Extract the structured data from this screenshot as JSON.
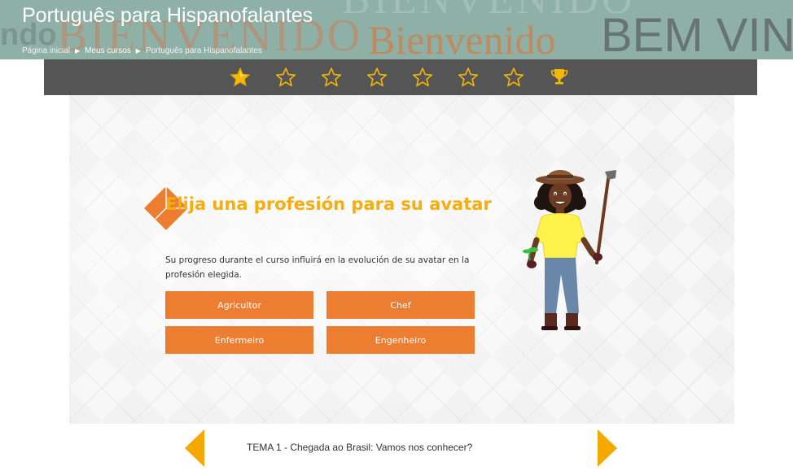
{
  "header": {
    "title": "Português para Hispanofalantes",
    "banner_words": [
      "BIENVENIDO",
      "BIENVENIDO",
      "ndo",
      "Bienvenido",
      "BEM VIND"
    ],
    "breadcrumb": [
      {
        "label": "Página inicial"
      },
      {
        "label": "Meus cursos"
      },
      {
        "label": "Português para Hispanofalantes"
      }
    ]
  },
  "progress": {
    "stars_total": 7,
    "stars_filled": 1,
    "star_filled_icon": "star-filled-icon",
    "star_empty_icon": "star-outline-icon",
    "final_icon": "trophy-icon",
    "accent_color": "#f5b800"
  },
  "main": {
    "heading": "Elija una profesión para su avatar",
    "description": "Su progreso durante el curso influirá en la evolución de su avatar en la profesión elegida.",
    "professions": [
      {
        "label": "Agricultor"
      },
      {
        "label": "Chef"
      },
      {
        "label": "Enfermeiro"
      },
      {
        "label": "Engenheiro"
      }
    ],
    "button_color": "#ed7d31",
    "heading_color": "#f5ad10",
    "avatar_icon": "farmer-avatar-icon"
  },
  "footer_nav": {
    "topic": "TEMA 1 - Chegada ao Brasil: Vamos nos conhecer?",
    "prev_icon": "arrow-left-icon",
    "next_icon": "arrow-right-icon"
  }
}
